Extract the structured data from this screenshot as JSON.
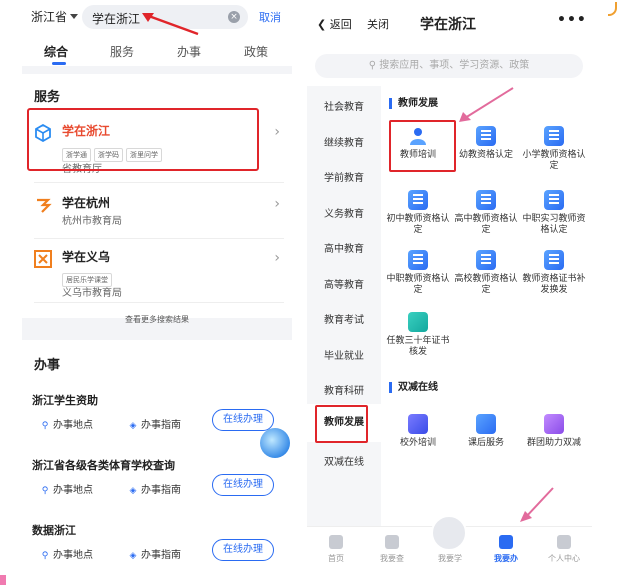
{
  "left": {
    "region": "浙江省",
    "search_value": "学在浙江",
    "cancel": "取消",
    "tabs": [
      "综合",
      "服务",
      "办事",
      "政策"
    ],
    "services_title": "服务",
    "services": [
      {
        "name_hl": "学在浙江",
        "name_rest": "",
        "tags": [
          "浙学通",
          "浙学码",
          "浙里问学"
        ],
        "sub": "省教育厅"
      },
      {
        "name_hl": "",
        "name_rest": "学在杭州",
        "tags": [],
        "sub": "杭州市教育局"
      },
      {
        "name_hl": "",
        "name_rest": "学在义乌",
        "tags": [
          "居民乐学课堂"
        ],
        "sub": "义乌市教育局"
      }
    ],
    "more_results": "查看更多搜索结果",
    "work_title": "办事",
    "work_items": [
      {
        "name": "浙江学生资助",
        "loc": "办事地点",
        "guide": "办事指南",
        "online": "在线办理"
      },
      {
        "name": "浙江省各级各类体育学校查询",
        "loc": "办事地点",
        "guide": "办事指南",
        "online": "在线办理"
      },
      {
        "name": "数据浙江",
        "loc": "办事地点",
        "guide": "办事指南",
        "online": "在线办理"
      }
    ]
  },
  "right": {
    "back": "返回",
    "close": "关闭",
    "title": "学在浙江",
    "more": "•••",
    "search_placeholder": "搜索应用、事项、学习资源、政策",
    "nav": [
      "社会教育",
      "继续教育",
      "学前教育",
      "义务教育",
      "高中教育",
      "高等教育",
      "教育考试",
      "毕业就业",
      "教育科研",
      "教师发展",
      "双减在线"
    ],
    "section1": "教师发展",
    "section1_items": [
      "教师培训",
      "幼教资格认定",
      "小学教师资格认定",
      "初中教师资格认定",
      "高中教师资格认定",
      "中职实习教师资格认定",
      "中职教师资格认定",
      "高校教师资格认定",
      "教师资格证书补发换发",
      "任教三十年证书核发"
    ],
    "section2": "双减在线",
    "section2_items": [
      "校外培训",
      "课后服务",
      "群团助力双减"
    ],
    "bottom_nav": [
      "首页",
      "我要查",
      "我要学",
      "我要办",
      "个人中心"
    ]
  }
}
